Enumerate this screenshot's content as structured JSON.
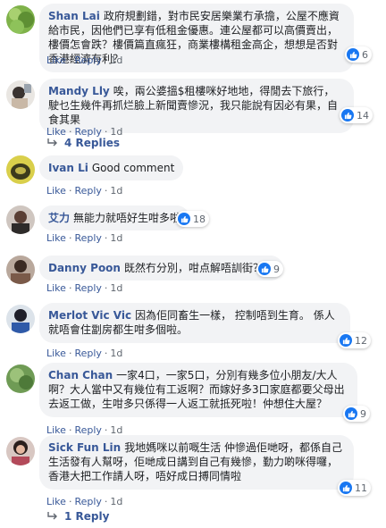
{
  "comments": [
    {
      "author": "Shan Lai",
      "text": "政府規劃錯，對市民安居樂業冇承擔，公屋不應資給市民，因他們已享有低租金優惠。連公屋都可以高價賣出，樓價怎會跌？樓價篇直瘋狂，商業樓構租金高企，想想是否對香港經濟有利？",
      "like_label": "Like",
      "reply_label": "Reply",
      "time": "1d",
      "reactions": "6"
    },
    {
      "author": "Mandy Lly",
      "text": "唉，兩公婆搵$租樓咪好地地，得閒去下旅行，駛乜生幾件再抓烂臉上新聞賣慘況，我只能說有因必有果，自食其果",
      "like_label": "Like",
      "reply_label": "Reply",
      "time": "1d",
      "reactions": "14"
    },
    {
      "replies_label": "4 Replies"
    },
    {
      "author": "Ivan Li",
      "text": "Good comment",
      "like_label": "Like",
      "reply_label": "Reply",
      "time": "1d"
    },
    {
      "author": "艾力",
      "text": "無能力就唔好生咁多啦",
      "like_label": "Like",
      "reply_label": "Reply",
      "time": "1d",
      "reactions": "18"
    },
    {
      "author": "Danny Poon",
      "text": "既然冇分別，咁点解唔訓街？？",
      "like_label": "Like",
      "reply_label": "Reply",
      "time": "1d",
      "reactions": "9"
    },
    {
      "author": "Merlot Vic Vic",
      "text": "因為佢同畜生一樣， 控制唔到生育。 係人就唔會住劏房都生咁多個啦。",
      "like_label": "Like",
      "reply_label": "Reply",
      "time": "1d",
      "reactions": "12"
    },
    {
      "author": "Chan Chan",
      "text": "一家4口，一家5口，分別有幾多位小朋友/大人啊？大人當中又有幾位有工返啊？而嫁好多3口家庭都要父母出去返工做，生咁多只係得一人返工就抵死啦！仲想住大屋？",
      "like_label": "Like",
      "reply_label": "Reply",
      "time": "1d",
      "reactions": "9"
    },
    {
      "author": "Sick Fun Lin",
      "text": "我地媽咪以前嘅生活 仲慘過佢哋呀，都係自己生活發有人幫呀，佢哋成日講到自己有幾慘，勤力啲咪得囉，香港大把工作請人呀，唔好成日搏同情啦",
      "like_label": "Like",
      "reply_label": "Reply",
      "time": "1d",
      "reactions": "11"
    },
    {
      "replies_label": "1 Reply"
    }
  ],
  "colors": {
    "link": "#385898",
    "bubble": "#f2f3f5",
    "like_blue": "#1877f2",
    "meta": "#606770"
  }
}
